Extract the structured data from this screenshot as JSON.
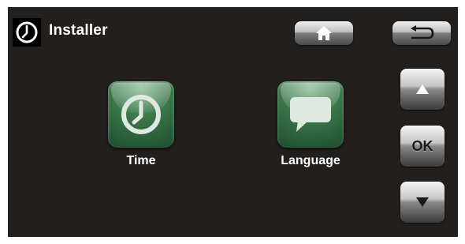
{
  "header": {
    "title": "Installer",
    "icon": "clock-icon"
  },
  "toolbar": {
    "home_icon": "home-icon",
    "back_icon": "back-arrow-icon"
  },
  "menu": {
    "items": [
      {
        "label": "Time",
        "icon": "clock-icon"
      },
      {
        "label": "Language",
        "icon": "speech-bubble-icon"
      }
    ]
  },
  "nav": {
    "up_icon": "arrow-up-icon",
    "ok_label": "OK",
    "down_icon": "arrow-down-icon"
  },
  "colors": {
    "background": "#221f1d",
    "tile_green": "#3d7a4d",
    "text": "#ffffff"
  }
}
